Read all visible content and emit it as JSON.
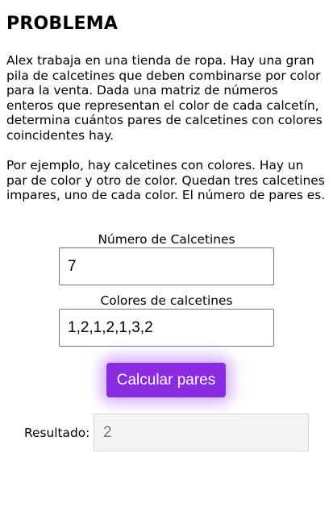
{
  "problem": {
    "title": "PROBLEMA",
    "description": "Alex trabaja en una tienda de ropa. Hay una gran pila de calcetines que deben combinarse por color para la venta. Dada una matriz de números enteros que representan el color de cada calcetín, determina cuántos pares de calcetines con colores coincidentes hay.",
    "example": "Por ejemplo, hay calcetines con colores. Hay un par de color y otro de color. Quedan tres calcetines impares, uno de cada color. El número de pares es."
  },
  "form": {
    "count_label": "Número de Calcetines",
    "count_value": "7",
    "colors_label": "Colores de calcetines",
    "colors_value": "1,2,1,2,1,3,2",
    "button_label": "Calcular pares",
    "result_label": "Resultado:",
    "result_value": "2"
  },
  "colors": {
    "button_bg": "#8a2be2",
    "button_glow": "#a65af5",
    "button_text": "#ffffff"
  }
}
